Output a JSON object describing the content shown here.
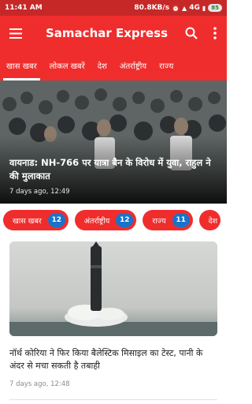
{
  "status_bar": {
    "time": "11:41 AM",
    "speed": "80.8KB/s",
    "network": "4G",
    "battery": "85"
  },
  "app_bar": {
    "title": "Samachar Express",
    "menu_icon": "hamburger-menu-icon",
    "search_icon": "search-icon",
    "more_icon": "more-vert-icon"
  },
  "tabs": [
    {
      "label": "खास खबर",
      "active": true
    },
    {
      "label": "लोकल खबरें",
      "active": false
    },
    {
      "label": "देश",
      "active": false
    },
    {
      "label": "अंतर्राष्ट्रीय",
      "active": false
    },
    {
      "label": "राज्य",
      "active": false
    }
  ],
  "hero": {
    "headline": "वायनाड: NH-766 पर यात्रा बैन के विरोध में युवा, राहुल ने की मुलाकात",
    "time": "7 days ago, 12:49"
  },
  "chips": [
    {
      "label": "खास खबर",
      "count": "12"
    },
    {
      "label": "अंतर्राष्ट्रीय",
      "count": "12"
    },
    {
      "label": "राज्य",
      "count": "11"
    },
    {
      "label": "देश",
      "count": ""
    }
  ],
  "card": {
    "headline": "नॉर्थ कोरिया ने फिर किया बैलेस्टिक मिसाइल का टेस्ट, पानी के अंदर से मचा सकती है तबाही",
    "time": "7 days ago, 12:48"
  },
  "colors": {
    "status_bar": "#c62828",
    "app_bar": "#f02d2d",
    "badge": "#1a73c8"
  }
}
